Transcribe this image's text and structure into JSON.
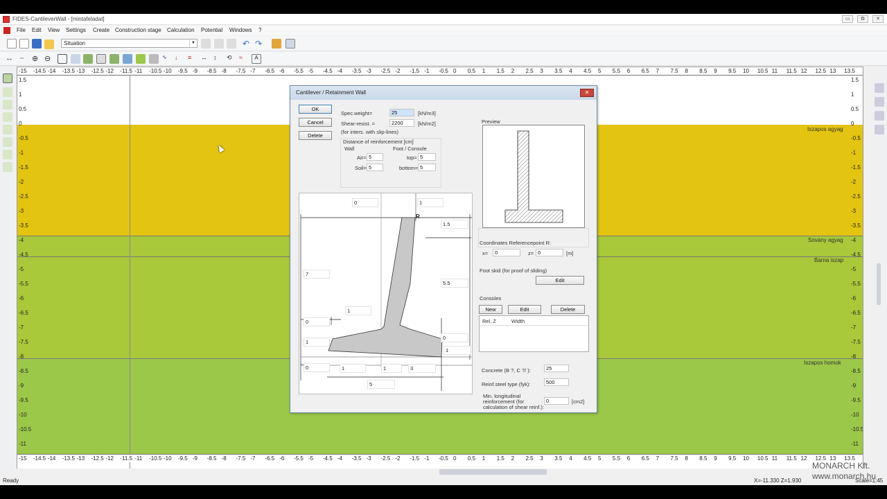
{
  "window": {
    "title": "FIDES-CantileverWall - [mintafeladat]",
    "buttons": {
      "minimize": "▭",
      "restore": "⧉",
      "close": "✕"
    }
  },
  "menu": [
    "File",
    "Edit",
    "View",
    "Settings",
    "Create",
    "Construction stage",
    "Calculation",
    "Potential",
    "Windows",
    "?"
  ],
  "toolbar": {
    "situation": "Situation"
  },
  "ruler": {
    "ticks": [
      "-15",
      "-14.5",
      "-14",
      "-13.5",
      "-13",
      "-12.5",
      "-12",
      "-11.5",
      "-11",
      "-10.5",
      "-10",
      "-9.5",
      "-9",
      "-8.5",
      "-8",
      "-7.5",
      "-7",
      "-6.5",
      "-6",
      "-5.5",
      "-5",
      "-4.5",
      "-4",
      "-3.5",
      "-3",
      "-2.5",
      "-2",
      "-1.5",
      "-1",
      "-0.5",
      "0",
      "0.5",
      "1",
      "1.5",
      "2",
      "2.5",
      "3",
      "3.5",
      "4",
      "4.5",
      "5",
      "5.5",
      "6",
      "6.5",
      "7",
      "7.5",
      "8",
      "8.5",
      "9",
      "9.5",
      "10",
      "10.5",
      "11",
      "11.5",
      "12",
      "12.5",
      "13",
      "13.5"
    ],
    "left_y": [
      "1.5",
      "1",
      "0.5",
      "0",
      "-0.5",
      "-1",
      "-1.5",
      "-2",
      "-2.5",
      "-3",
      "-3.5",
      "-4",
      "-4.5",
      "-5",
      "-5.5",
      "-6",
      "-6.5",
      "-7",
      "-7.5",
      "-8",
      "-8.5",
      "-9",
      "-9.5",
      "-10",
      "-10.5",
      "-11"
    ],
    "right_y": [
      "1.5",
      "1",
      "0.5",
      "0",
      "-0.5",
      "-1",
      "-1.5",
      "-2",
      "-2.5",
      "-3",
      "-3.5",
      "-4",
      "-4.5",
      "-5",
      "-5.5",
      "-6",
      "-6.5",
      "-7",
      "-7.5",
      "-8",
      "-8.5",
      "-9",
      "-9.5",
      "-10",
      "-10.5",
      "-11"
    ]
  },
  "soil_layers": [
    {
      "name": "Iszapos agyag",
      "color": "#e3c411"
    },
    {
      "name": "Sovány agyag",
      "color": "#a9c83a"
    },
    {
      "name": "Barna iszap",
      "color": "#a9c83a"
    },
    {
      "name": "Iszapos homok",
      "color": "#9cc84a"
    }
  ],
  "dialog": {
    "title": "Cantilever / Retainment Wall",
    "close_label": "✕",
    "ok": "OK",
    "cancel": "Cancel",
    "delete": "Delete",
    "spec_weight_label": "Spec.weight=",
    "spec_weight_value": "25",
    "spec_weight_unit": "[kN/m3]",
    "shear_label": "Shear-resist. =",
    "shear_value": "2200",
    "shear_unit": "[kN/m2]",
    "shear_note": "(for inters. with slip-lines)",
    "reinf_title": "Distance of reinforcement [cm]",
    "wall_label": "Wall",
    "foot_label": "Foot / Console",
    "air_label": "Air=",
    "air_value": "5",
    "soil_label": "Soil=",
    "soil_value": "5",
    "top_label": "top=",
    "top_value": "5",
    "bottom_label": "bottom=",
    "bottom_value": "5",
    "preview_label": "Preview",
    "coords_label": "Coordinates Referencepoint R:",
    "x_label": "x=",
    "x_value": "0",
    "z_label": "z=",
    "z_value": "0",
    "coord_unit": "[m]",
    "foot_skid_label": "Foot skid (for proof of sliding)",
    "edit": "Edit",
    "consoles_label": "Consoles",
    "new": "New",
    "edit2": "Edit",
    "delete2": "Delete",
    "col_relz": "Rel. Z",
    "col_width": "Width",
    "concrete_label": "Concrete (B ?, C ?/ ):",
    "concrete_value": "25",
    "steel_label": "Reinf.steel type (fyk):",
    "steel_value": "500",
    "minlong_label1": "Min. longitudinal",
    "minlong_label2": "reinforcement (for",
    "minlong_label3": "calculation of shear reinf.):",
    "minlong_value": "0",
    "minlong_unit": "[cm2]",
    "dims": {
      "top_left": "0",
      "top_right": "1",
      "r_label": "R",
      "d15": "1.5",
      "d7": "7",
      "d55": "5.5",
      "d1_mid": "1",
      "d0_left": "0",
      "d1_left": "1",
      "d0_right": "0",
      "d1_right": "1",
      "b0": "0",
      "b1a": "1",
      "b1b": "1",
      "b3": "3",
      "b5": "5"
    }
  },
  "status": {
    "ready": "Ready",
    "coords": "X=-11.330  Z=1.930",
    "scale": "Scale=1:45"
  },
  "watermark": {
    "line1": "MONARCH Kft.",
    "line2": "www.monarch.hu"
  }
}
